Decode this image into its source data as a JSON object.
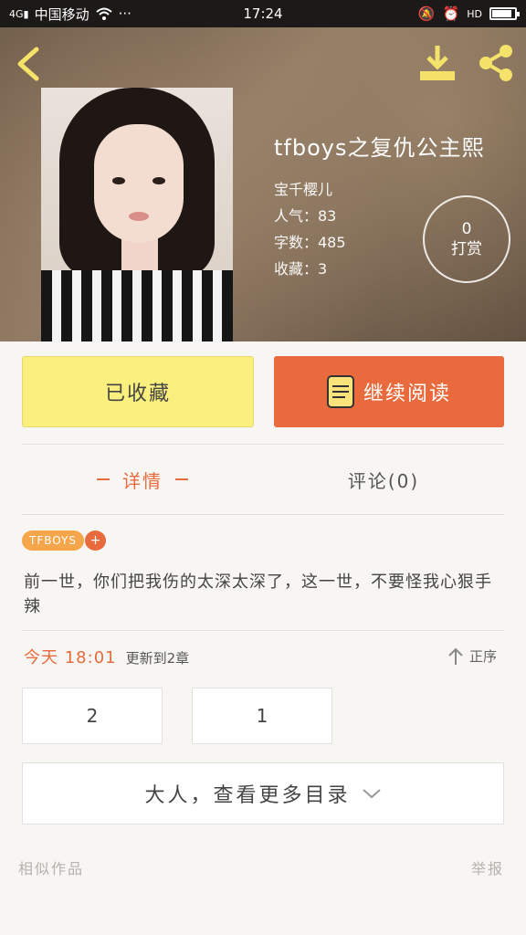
{
  "status_bar": {
    "carrier": "中国移动",
    "time": "17:24",
    "network": "4G",
    "hd": "HD"
  },
  "book": {
    "title": "tfboys之复仇公主熙",
    "author": "宝千樱儿",
    "popularity": "人气：83",
    "word_count": "字数：485",
    "favorites": "收藏：3"
  },
  "reward": {
    "count": "0",
    "label": "打赏"
  },
  "actions": {
    "favorited_label": "已收藏",
    "continue_label": "继续阅读"
  },
  "tabs": [
    {
      "label": "详情",
      "active": true
    },
    {
      "label": "评论(0)",
      "active": false
    }
  ],
  "tags": {
    "primary": "TFBOYS",
    "add": "+"
  },
  "description": "前一世，你们把我伤的太深太深了，这一世，不要怪我心狠手辣",
  "update": {
    "time": "今天 18:01",
    "text": "更新到2章",
    "sort_label": "正序"
  },
  "chapters": [
    "2",
    "1"
  ],
  "more_chapters": "大人，查看更多目录",
  "footer": {
    "similar": "相似作品",
    "report": "举报"
  },
  "colors": {
    "accent": "#e96a3c",
    "fav_bg": "#fbf07d",
    "tag": "#f5a64a"
  }
}
